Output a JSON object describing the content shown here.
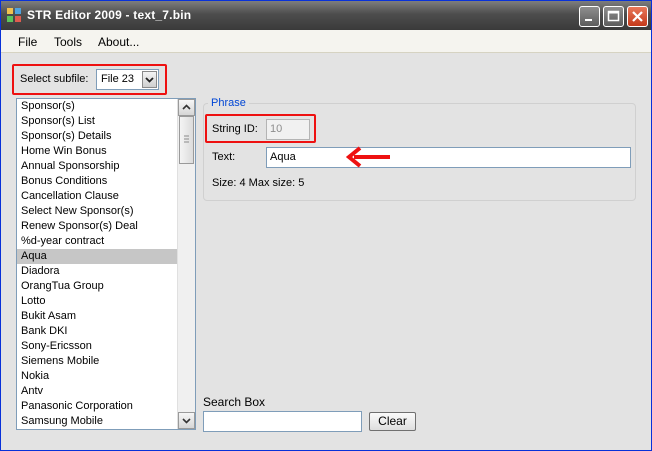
{
  "window": {
    "title": "STR Editor 2009 - text_7.bin"
  },
  "menu": {
    "items": [
      "File",
      "Tools",
      "About..."
    ]
  },
  "subfile": {
    "label": "Select subfile:",
    "value": "File 23"
  },
  "list": {
    "items": [
      "Sponsor(s)",
      "Sponsor(s) List",
      "Sponsor(s) Details",
      "Home Win Bonus",
      "Annual Sponsorship",
      "Bonus Conditions",
      "Cancellation Clause",
      "Select New Sponsor(s)",
      "Renew  Sponsor(s) Deal",
      "%d-year contract",
      "Aqua",
      "Diadora",
      "OrangTua Group",
      "Lotto",
      "Bukit Asam",
      "Bank DKI",
      "Sony-Ericsson",
      "Siemens Mobile",
      "Nokia",
      "Antv",
      "Panasonic Corporation",
      "Samsung Mobile"
    ],
    "selected_index": 10
  },
  "phrase": {
    "group_title": "Phrase",
    "string_id_label": "String ID:",
    "string_id_value": "10",
    "text_label": "Text:",
    "text_value": "Aqua",
    "size_info": "Size: 4 Max size: 5"
  },
  "search": {
    "label": "Search Box",
    "value": "",
    "clear_label": "Clear"
  },
  "colors": {
    "highlight_red": "#ee1111",
    "group_title": "#0046d5",
    "selection": "#c6c6c6"
  },
  "icons": {
    "annotation_arrow": "red-arrow-icon"
  }
}
